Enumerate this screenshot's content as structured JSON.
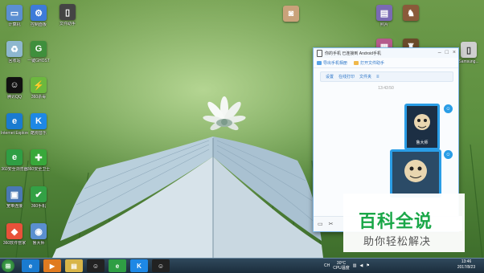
{
  "desktop_icons": [
    {
      "label": "计算机",
      "icon": "computer-icon",
      "color": "#5b8fd1",
      "glyph": "▭"
    },
    {
      "label": "控制面板",
      "icon": "control-panel-icon",
      "color": "#3d7bd8",
      "glyph": "⚙"
    },
    {
      "label": "回收站",
      "icon": "recycle-bin-icon",
      "color": "#8eb7cf",
      "glyph": "♻"
    },
    {
      "label": "一键GHOST",
      "icon": "ghost-icon",
      "color": "#3f8f3c",
      "glyph": "G"
    },
    {
      "label": "腾讯QQ",
      "icon": "qq-icon",
      "color": "#111111",
      "glyph": "☺"
    },
    {
      "label": "360杀毒",
      "icon": "antivirus-icon",
      "color": "#6cb83e",
      "glyph": "⚡"
    },
    {
      "label": "Internet Explorer",
      "icon": "ie-icon",
      "color": "#1a7bd0",
      "glyph": "e"
    },
    {
      "label": "酷狗音乐",
      "icon": "kugou-icon",
      "color": "#1e88e5",
      "glyph": "K"
    },
    {
      "label": "360安全浏览器",
      "icon": "browser-icon",
      "color": "#2f9e44",
      "glyph": "e"
    },
    {
      "label": "360安全卫士",
      "icon": "security-icon",
      "color": "#38a83a",
      "glyph": "✚"
    },
    {
      "label": "宽带连接",
      "icon": "broadband-icon",
      "color": "#4a78b3",
      "glyph": "▣"
    },
    {
      "label": "360手机",
      "icon": "shield-icon",
      "color": "#33a145",
      "glyph": "✔"
    },
    {
      "label": "360软件管家",
      "icon": "software-manager-icon",
      "color": "#e8513a",
      "glyph": "◆"
    },
    {
      "label": "鲁大师",
      "icon": "ludashi-icon",
      "color": "#5a8fcf",
      "glyph": "◉"
    }
  ],
  "top_icons": [
    {
      "label": "",
      "icon": "camera-icon",
      "color": "#c9a27a",
      "glyph": "◙"
    },
    {
      "label": "",
      "icon": "tool-icon",
      "color": "#6c6c6c",
      "glyph": "▯"
    }
  ],
  "right_icons": [
    {
      "label": "照片",
      "icon": "photo-icon",
      "color": "#7a6ab3",
      "glyph": "▤"
    },
    {
      "label": "",
      "icon": "game-icon",
      "color": "#8a5a3a",
      "glyph": "♞"
    },
    {
      "label": "",
      "icon": "picture-icon",
      "color": "#b55a8c",
      "glyph": "▦"
    },
    {
      "label": "",
      "icon": "game2-icon",
      "color": "#6a4a2a",
      "glyph": "♜"
    },
    {
      "label": "Samsung...",
      "icon": "phone-icon",
      "color": "#cfcfcf",
      "glyph": "▯"
    }
  ],
  "chat": {
    "title": "你的手机 已连接到 Android手机",
    "toolbar": [
      {
        "label": "导出手机相册",
        "icon": "export-album-icon"
      },
      {
        "label": "打开文件助手",
        "icon": "file-assistant-icon"
      }
    ],
    "notice": [
      "设置",
      "在线打印",
      "文件夹"
    ],
    "time": "13:43:50",
    "image_caption": "鲁大师"
  },
  "watermark": {
    "title": "百科全说",
    "subtitle": "助你轻松解决"
  },
  "taskbar": {
    "apps": [
      {
        "name": "start-button",
        "glyph": "⊞",
        "color": "#2d7d3a"
      },
      {
        "name": "ie-taskbar",
        "glyph": "e",
        "color": "#1a7bd0"
      },
      {
        "name": "media-taskbar",
        "glyph": "▶",
        "color": "#e07b20"
      },
      {
        "name": "explorer-taskbar",
        "glyph": "▤",
        "color": "#d8b548"
      },
      {
        "name": "qq-taskbar",
        "glyph": "☺",
        "color": "#222222"
      },
      {
        "name": "browser-taskbar",
        "glyph": "e",
        "color": "#2f9e44"
      },
      {
        "name": "kugou-taskbar",
        "glyph": "K",
        "color": "#1e88e5"
      },
      {
        "name": "qq2-taskbar",
        "glyph": "☺",
        "color": "#222222"
      }
    ],
    "tray": {
      "lang": "CH",
      "temp": "30°C",
      "cpu": "CPU温度"
    },
    "clock": {
      "time": "13:46",
      "date": "2017/8/23"
    }
  }
}
